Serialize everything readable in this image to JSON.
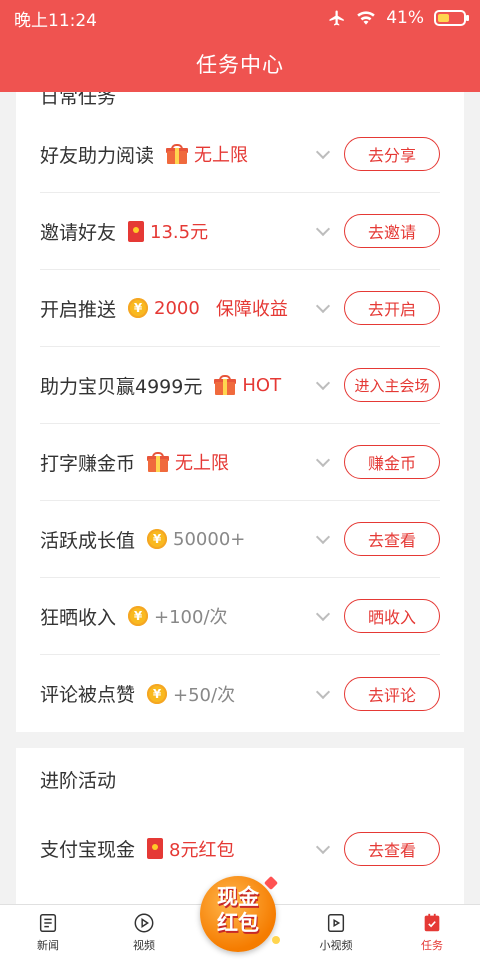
{
  "status_bar": {
    "time": "晚上11:24",
    "battery": "41%",
    "battery_level": 0.41
  },
  "header": {
    "title": "任务中心"
  },
  "section1": {
    "partial_title": "日常任务"
  },
  "tasks": [
    {
      "title": "好友助力阅读",
      "icon": "gift-icon",
      "reward": "无上限",
      "extra": "",
      "button": "去分享"
    },
    {
      "title": "邀请好友",
      "icon": "envelope-icon",
      "reward": "13.5元",
      "extra": "",
      "button": "去邀请"
    },
    {
      "title": "开启推送",
      "icon": "coin-icon",
      "reward": "2000",
      "extra": "保障收益",
      "button": "去开启"
    },
    {
      "title": "助力宝贝赢4999元",
      "icon": "gift-icon",
      "reward": "HOT",
      "extra": "",
      "button": "进入主会场"
    },
    {
      "title": "打字赚金币",
      "icon": "gift-icon",
      "reward": "无上限",
      "extra": "",
      "button": "赚金币"
    },
    {
      "title": "活跃成长值",
      "icon": "coin-icon",
      "reward": "50000+",
      "extra": "",
      "button": "去查看"
    },
    {
      "title": "狂晒收入",
      "icon": "coin-icon",
      "reward": "+100/次",
      "extra": "",
      "button": "晒收入"
    },
    {
      "title": "评论被点赞",
      "icon": "coin-icon",
      "reward": "+50/次",
      "extra": "",
      "button": "去评论"
    }
  ],
  "section2": {
    "title": "进阶活动",
    "tasks": [
      {
        "title": "支付宝现金",
        "icon": "envelope-icon",
        "reward": "8元红包",
        "button": "去查看"
      }
    ]
  },
  "coin_symbol": "¥",
  "floating_badge": {
    "line1": "现金",
    "line2": "红包"
  },
  "bottom_nav": [
    {
      "label": "新闻",
      "icon": "news-icon"
    },
    {
      "label": "视频",
      "icon": "video-icon"
    },
    {
      "label": "小视频",
      "icon": "short-video-icon"
    },
    {
      "label": "任务",
      "icon": "task-icon",
      "active": true
    }
  ],
  "colors": {
    "accent": "#ef5350",
    "reward": "#e53935",
    "coin": "#f9b91f"
  }
}
